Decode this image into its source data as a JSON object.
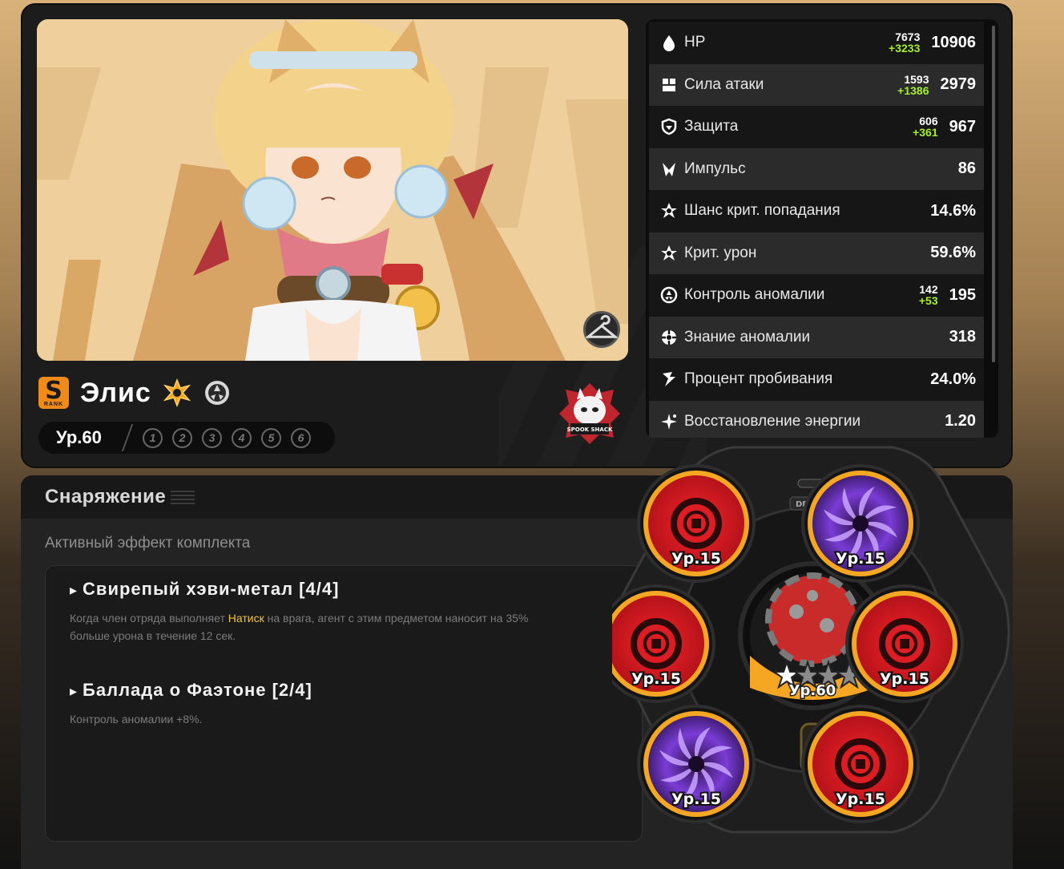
{
  "character": {
    "name": "Элис",
    "rank": "S",
    "rank_sub": "RANK",
    "level": "Ур.60",
    "mindscape": [
      "1",
      "2",
      "3",
      "4",
      "5",
      "6"
    ],
    "faction": "SPOOK SHACK"
  },
  "stats": [
    {
      "label": "HP",
      "icon": "hp-drop-icon",
      "base": "7673",
      "bonus": "+3233",
      "total": "10906"
    },
    {
      "label": "Сила атаки",
      "icon": "attack-icon",
      "base": "1593",
      "bonus": "+1386",
      "total": "2979"
    },
    {
      "label": "Защита",
      "icon": "defense-shield-icon",
      "base": "606",
      "bonus": "+361",
      "total": "967"
    },
    {
      "label": "Импульс",
      "icon": "impact-icon",
      "base": "",
      "bonus": "",
      "total": "86"
    },
    {
      "label": "Шанс крит. попадания",
      "icon": "crit-rate-icon",
      "base": "",
      "bonus": "",
      "total": "14.6%"
    },
    {
      "label": "Крит. урон",
      "icon": "crit-dmg-icon",
      "base": "",
      "bonus": "",
      "total": "59.6%"
    },
    {
      "label": "Контроль аномалии",
      "icon": "anomaly-mastery-icon",
      "base": "142",
      "bonus": "+53",
      "total": "195"
    },
    {
      "label": "Знание аномалии",
      "icon": "anomaly-proficiency-icon",
      "base": "",
      "bonus": "",
      "total": "318"
    },
    {
      "label": "Процент пробивания",
      "icon": "pen-ratio-icon",
      "base": "",
      "bonus": "",
      "total": "24.0%"
    },
    {
      "label": "Восстановление энергии",
      "icon": "energy-regen-icon",
      "base": "",
      "bonus": "",
      "total": "1.20"
    }
  ],
  "equipment": {
    "title": "Снаряжение",
    "active_set_label": "Активный эффект комплекта",
    "sets": [
      {
        "name": "Свирепый хэви-метал [4/4]",
        "desc_before": "Когда член отряда выполняет ",
        "desc_highlight": "Натиск",
        "desc_after": " на врага, агент с этим предметом наносит на 35% больше урона в течение 12 сек."
      },
      {
        "name": "Баллада о Фаэтоне [2/4]",
        "desc_before": "Контроль аномалии +8%.",
        "desc_highlight": "",
        "desc_after": ""
      }
    ]
  },
  "drive_discs": {
    "driver_label": "DRIVER",
    "engine_level": "Ур.60",
    "slots": [
      {
        "level": "Ур.15",
        "type": "red"
      },
      {
        "level": "Ур.15",
        "type": "purple"
      },
      {
        "level": "Ур.15",
        "type": "red"
      },
      {
        "level": "Ур.15",
        "type": "red"
      },
      {
        "level": "Ур.15",
        "type": "purple"
      },
      {
        "level": "Ур.15",
        "type": "red"
      }
    ]
  },
  "colors": {
    "accent": "#f5a623",
    "bonus": "#a6f02a",
    "highlight": "#f0c53a"
  }
}
